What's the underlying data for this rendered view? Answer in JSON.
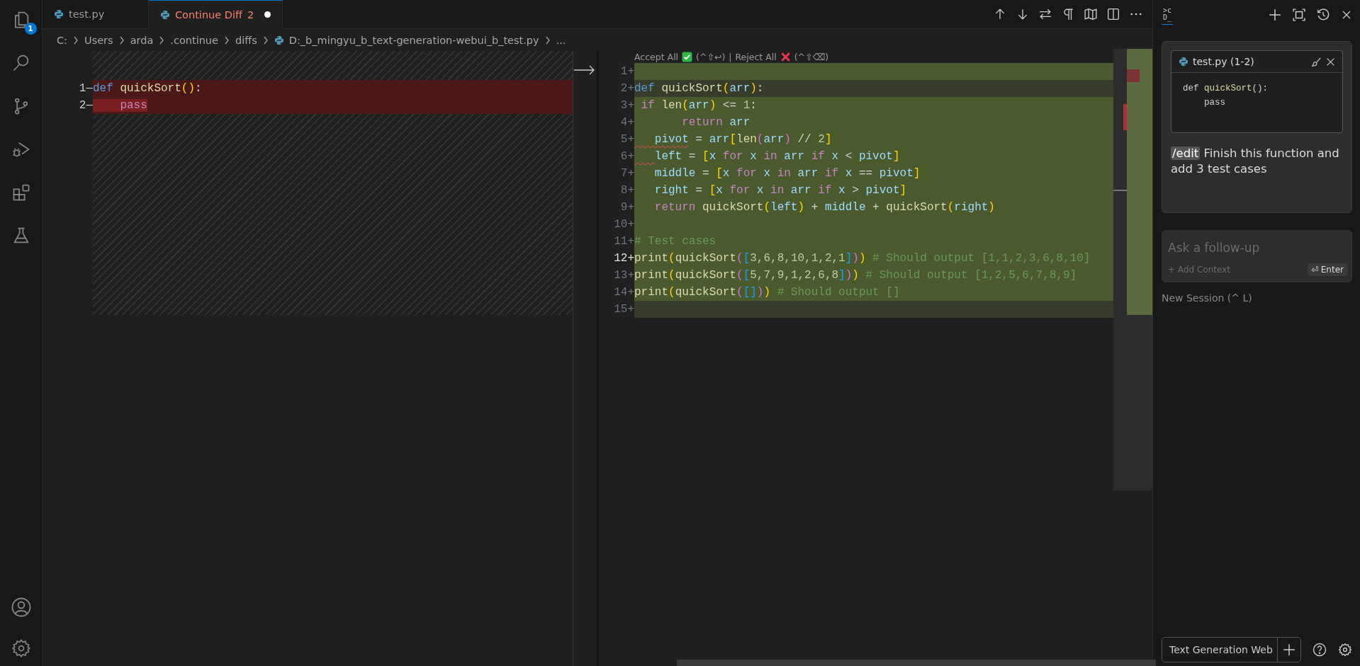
{
  "activity_bar": {
    "badge": "1"
  },
  "tabs": [
    {
      "label": "test.py",
      "selected": false,
      "modified": false,
      "has_errors": false
    },
    {
      "label": "Continue Diff",
      "problems": "2",
      "selected": true,
      "modified": true,
      "has_errors": true
    }
  ],
  "breadcrumb": [
    {
      "label": "C:",
      "kind": "folder"
    },
    {
      "label": "Users",
      "kind": "folder"
    },
    {
      "label": "arda",
      "kind": "folder"
    },
    {
      "label": ".continue",
      "kind": "folder"
    },
    {
      "label": "diffs",
      "kind": "folder"
    },
    {
      "label": "D:_b_mingyu_b_text-generation-webui_b_test.py",
      "kind": "file"
    },
    {
      "label": "...",
      "kind": "more"
    }
  ],
  "diff": {
    "left": {
      "lines": [
        {
          "number": "1",
          "sign": "—",
          "tokens": [
            {
              "text": "def ",
              "kind": "keyword"
            },
            {
              "text": "quickSort",
              "kind": "function"
            },
            {
              "text": "()",
              "kind": "bracket1"
            },
            {
              "text": ":",
              "kind": "plain"
            }
          ]
        },
        {
          "number": "2",
          "sign": "—",
          "tokens": [
            {
              "text": "    pass",
              "kind": "control_deleted"
            }
          ]
        }
      ]
    },
    "right": {
      "codelens": {
        "accept": "Accept All",
        "accept_keys": "(^⇧↩)",
        "separator": "|",
        "reject": "Reject All",
        "reject_keys": "(^⇧⌫)"
      },
      "lines": [
        {
          "number": "1",
          "sign": "+",
          "highlighted": false,
          "cursor": false
        },
        {
          "number": "2",
          "sign": "+",
          "highlighted": true,
          "cursor": false,
          "tokens": [
            {
              "text": "def ",
              "kind": "keyword"
            },
            {
              "text": "quickSort",
              "kind": "function"
            },
            {
              "text": "(",
              "kind": "bracket1"
            },
            {
              "text": "arr",
              "kind": "variable"
            },
            {
              "text": ")",
              "kind": "bracket1"
            },
            {
              "text": ":",
              "kind": "plain"
            }
          ]
        },
        {
          "number": "3",
          "sign": "+",
          "highlighted": false,
          "cursor": false,
          "tokens": [
            {
              "text": " if ",
              "kind": "control"
            },
            {
              "text": "len",
              "kind": "function"
            },
            {
              "text": "(",
              "kind": "bracket1"
            },
            {
              "text": "arr",
              "kind": "variable"
            },
            {
              "text": ")",
              "kind": "bracket1"
            },
            {
              "text": " <= ",
              "kind": "plain"
            },
            {
              "text": "1",
              "kind": "number"
            },
            {
              "text": ":",
              "kind": "plain"
            }
          ]
        },
        {
          "number": "4",
          "sign": "+",
          "highlighted": false,
          "cursor": false,
          "tokens": [
            {
              "text": "       return ",
              "kind": "control"
            },
            {
              "text": "arr",
              "kind": "variable"
            }
          ]
        },
        {
          "number": "5",
          "sign": "+",
          "highlighted": false,
          "cursor": false,
          "tokens": [
            {
              "text": "   pivot",
              "kind": "variable_error"
            },
            {
              "text": " = ",
              "kind": "plain"
            },
            {
              "text": "arr",
              "kind": "variable"
            },
            {
              "text": "[",
              "kind": "bracket1"
            },
            {
              "text": "len",
              "kind": "function"
            },
            {
              "text": "(",
              "kind": "bracket2"
            },
            {
              "text": "arr",
              "kind": "variable"
            },
            {
              "text": ")",
              "kind": "bracket2"
            },
            {
              "text": " // ",
              "kind": "plain"
            },
            {
              "text": "2",
              "kind": "number"
            },
            {
              "text": "]",
              "kind": "bracket1"
            }
          ]
        },
        {
          "number": "6",
          "sign": "+",
          "highlighted": false,
          "cursor": false,
          "tokens": [
            {
              "text": "   left",
              "kind": "variable_indent_error"
            },
            {
              "text": " = ",
              "kind": "plain"
            },
            {
              "text": "[",
              "kind": "bracket1"
            },
            {
              "text": "x ",
              "kind": "variable"
            },
            {
              "text": "for",
              "kind": "control"
            },
            {
              "text": " x ",
              "kind": "variable"
            },
            {
              "text": "in",
              "kind": "control"
            },
            {
              "text": " arr ",
              "kind": "variable"
            },
            {
              "text": "if",
              "kind": "control"
            },
            {
              "text": " x ",
              "kind": "variable"
            },
            {
              "text": "< ",
              "kind": "plain"
            },
            {
              "text": "pivot",
              "kind": "variable"
            },
            {
              "text": "]",
              "kind": "bracket1"
            }
          ]
        },
        {
          "number": "7",
          "sign": "+",
          "highlighted": false,
          "cursor": false,
          "tokens": [
            {
              "text": "   middle",
              "kind": "variable"
            },
            {
              "text": " = ",
              "kind": "plain"
            },
            {
              "text": "[",
              "kind": "bracket1"
            },
            {
              "text": "x ",
              "kind": "variable"
            },
            {
              "text": "for",
              "kind": "control"
            },
            {
              "text": " x ",
              "kind": "variable"
            },
            {
              "text": "in",
              "kind": "control"
            },
            {
              "text": " arr ",
              "kind": "variable"
            },
            {
              "text": "if",
              "kind": "control"
            },
            {
              "text": " x ",
              "kind": "variable"
            },
            {
              "text": "== ",
              "kind": "plain"
            },
            {
              "text": "pivot",
              "kind": "variable"
            },
            {
              "text": "]",
              "kind": "bracket1"
            }
          ]
        },
        {
          "number": "8",
          "sign": "+",
          "highlighted": false,
          "cursor": false,
          "tokens": [
            {
              "text": "   right",
              "kind": "variable"
            },
            {
              "text": " = ",
              "kind": "plain"
            },
            {
              "text": "[",
              "kind": "bracket1"
            },
            {
              "text": "x ",
              "kind": "variable"
            },
            {
              "text": "for",
              "kind": "control"
            },
            {
              "text": " x ",
              "kind": "variable"
            },
            {
              "text": "in",
              "kind": "control"
            },
            {
              "text": " arr ",
              "kind": "variable"
            },
            {
              "text": "if",
              "kind": "control"
            },
            {
              "text": " x ",
              "kind": "variable"
            },
            {
              "text": "> ",
              "kind": "plain"
            },
            {
              "text": "pivot",
              "kind": "variable"
            },
            {
              "text": "]",
              "kind": "bracket1"
            }
          ]
        },
        {
          "number": "9",
          "sign": "+",
          "highlighted": false,
          "cursor": false,
          "tokens": [
            {
              "text": "   return ",
              "kind": "control"
            },
            {
              "text": "quickSort",
              "kind": "function"
            },
            {
              "text": "(",
              "kind": "bracket1"
            },
            {
              "text": "left",
              "kind": "variable"
            },
            {
              "text": ")",
              "kind": "bracket1"
            },
            {
              "text": " + ",
              "kind": "plain"
            },
            {
              "text": "middle",
              "kind": "variable"
            },
            {
              "text": " + ",
              "kind": "plain"
            },
            {
              "text": "quickSort",
              "kind": "function"
            },
            {
              "text": "(",
              "kind": "bracket1"
            },
            {
              "text": "right",
              "kind": "variable"
            },
            {
              "text": ")",
              "kind": "bracket1"
            }
          ]
        },
        {
          "number": "10",
          "sign": "+",
          "highlighted": false,
          "cursor": false
        },
        {
          "number": "11",
          "sign": "+",
          "highlighted": false,
          "cursor": false,
          "tokens": [
            {
              "text": "# Test cases",
              "kind": "comment"
            }
          ]
        },
        {
          "number": "12",
          "sign": "+",
          "highlighted": false,
          "cursor": true,
          "tokens": [
            {
              "text": "print",
              "kind": "function"
            },
            {
              "text": "(",
              "kind": "bracket1"
            },
            {
              "text": "quickSort",
              "kind": "function"
            },
            {
              "text": "(",
              "kind": "bracket2"
            },
            {
              "text": "[",
              "kind": "bracket3"
            },
            {
              "text": "3,6,8,10,1,2,1",
              "kind": "number"
            },
            {
              "text": "]",
              "kind": "bracket3"
            },
            {
              "text": ")",
              "kind": "bracket2"
            },
            {
              "text": ")",
              "kind": "bracket1"
            },
            {
              "text": " # Should output [1,1,2,3,6,8,10]",
              "kind": "comment"
            }
          ]
        },
        {
          "number": "13",
          "sign": "+",
          "highlighted": false,
          "cursor": false,
          "tokens": [
            {
              "text": "print",
              "kind": "function"
            },
            {
              "text": "(",
              "kind": "bracket1"
            },
            {
              "text": "quickSort",
              "kind": "function"
            },
            {
              "text": "(",
              "kind": "bracket2"
            },
            {
              "text": "[",
              "kind": "bracket3"
            },
            {
              "text": "5,7,9,1,2,6,8",
              "kind": "number"
            },
            {
              "text": "]",
              "kind": "bracket3"
            },
            {
              "text": ")",
              "kind": "bracket2"
            },
            {
              "text": ")",
              "kind": "bracket1"
            },
            {
              "text": " # Should output [1,2,5,6,7,8,9]",
              "kind": "comment"
            }
          ]
        },
        {
          "number": "14",
          "sign": "+",
          "highlighted": false,
          "cursor": false,
          "tokens": [
            {
              "text": "print",
              "kind": "function"
            },
            {
              "text": "(",
              "kind": "bracket1"
            },
            {
              "text": "quickSort",
              "kind": "function"
            },
            {
              "text": "(",
              "kind": "bracket2"
            },
            {
              "text": "[]",
              "kind": "bracket3"
            },
            {
              "text": ")",
              "kind": "bracket2"
            },
            {
              "text": ")",
              "kind": "bracket1"
            },
            {
              "text": " # Should output []",
              "kind": "comment"
            }
          ]
        },
        {
          "number": "15",
          "sign": "+",
          "highlighted": true,
          "cursor": false
        }
      ]
    }
  },
  "chat": {
    "logo": [
      ">c",
      "D_"
    ],
    "context": {
      "file": "test.py (1-2)",
      "lines": [
        [
          {
            "text": "def ",
            "kind": "plain"
          },
          {
            "text": "quickSort",
            "kind": "function"
          },
          {
            "text": "():",
            "kind": "plain"
          }
        ],
        [
          {
            "text": "    pass",
            "kind": "plain"
          }
        ]
      ]
    },
    "message": {
      "command": "/edit",
      "text": "Finish this function and add 3 test cases"
    },
    "input": {
      "placeholder": "Ask a follow-up",
      "add_context": "+ Add Context",
      "submit": "⏎ Enter"
    },
    "new_session": "New Session (^ L)",
    "model_select": {
      "value": "Text Generation Web"
    }
  }
}
